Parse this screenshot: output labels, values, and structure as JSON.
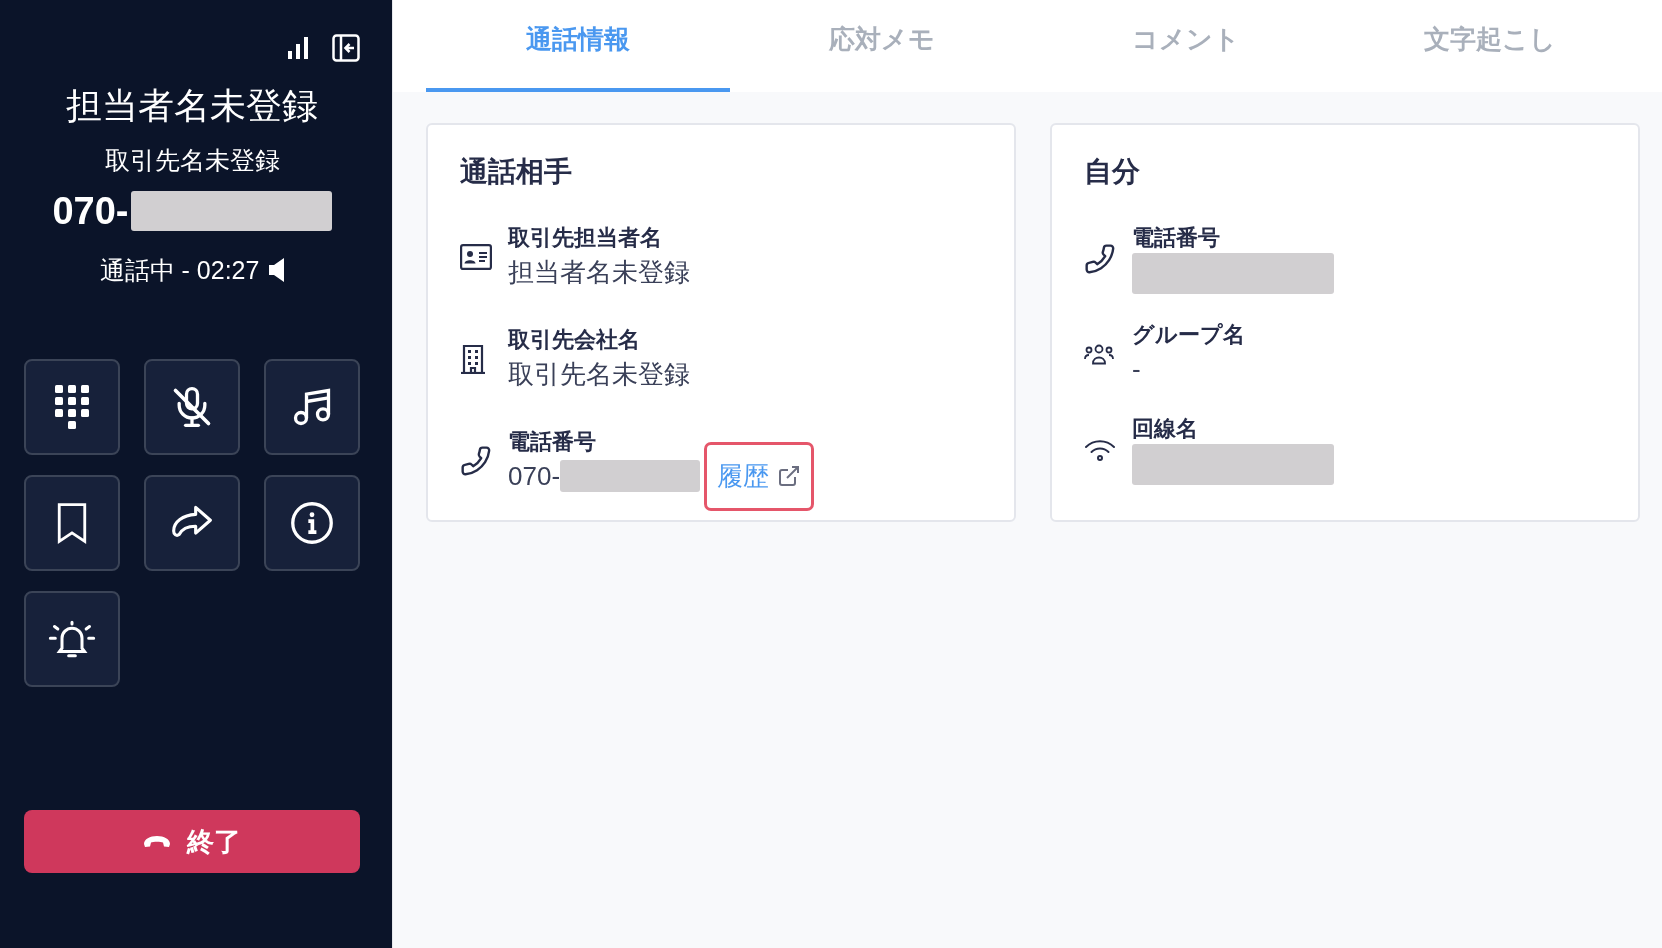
{
  "sidebar": {
    "contact_name": "担当者名未登録",
    "company_name": "取引先名未登録",
    "phone": {
      "value": "070-",
      "redacted": true
    },
    "status": "通話中 - 02:27",
    "end_button": "終了"
  },
  "tabs": [
    {
      "label": "通話情報",
      "selected": true
    },
    {
      "label": "応対メモ",
      "selected": false
    },
    {
      "label": "コメント",
      "selected": false
    },
    {
      "label": "文字起こし",
      "selected": false
    }
  ],
  "cards": [
    {
      "title": "通話相手",
      "fields": [
        {
          "label": "取引先担当者名",
          "value": "担当者名未登録"
        },
        {
          "label": "取引先会社名",
          "value": "取引先名未登録"
        },
        {
          "label": "電話番号",
          "value": "070-",
          "redacted": true,
          "link": {
            "label": "履歴",
            "highlighted": true
          }
        }
      ]
    },
    {
      "title": "自分",
      "fields": [
        {
          "label": "電話番号",
          "redacted": true
        },
        {
          "label": "グループ名",
          "value": "-"
        },
        {
          "label": "回線名",
          "redacted": true
        }
      ]
    }
  ]
}
